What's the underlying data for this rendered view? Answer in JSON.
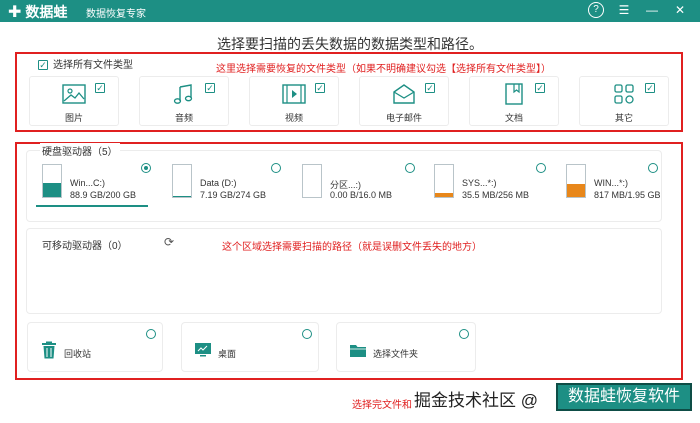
{
  "titlebar": {
    "logo_glyph": "✚",
    "app_name": "数据蛙",
    "subtitle": "数据恢复专家",
    "help_glyph": "?",
    "menu_glyph": "☰",
    "minimize_glyph": "—",
    "close_glyph": "✕",
    "color": "#1d8f84"
  },
  "heading": "选择要扫描的丢失数据的数据类型和路径。",
  "types": {
    "select_all_label": "选择所有文件类型",
    "check_glyph": "✓",
    "annotation": "这里选择需要恢复的文件类型（如果不明确建议勾选【选择所有文件类型】）",
    "items": [
      {
        "label": "图片",
        "icon": "image-icon"
      },
      {
        "label": "音频",
        "icon": "music-icon"
      },
      {
        "label": "视频",
        "icon": "video-icon"
      },
      {
        "label": "电子邮件",
        "icon": "email-icon"
      },
      {
        "label": "文档",
        "icon": "document-icon"
      },
      {
        "label": "其它",
        "icon": "other-icon"
      }
    ]
  },
  "drives": {
    "title": "硬盘驱动器（5）",
    "items": [
      {
        "name": "Win...C:)",
        "size": "88.9 GB/200 GB",
        "selected": true,
        "usage": 0.44,
        "fill": "#1d8f84"
      },
      {
        "name": "Data (D:)",
        "size": "7.19 GB/274 GB",
        "selected": false,
        "usage": 0.03,
        "fill": "#1d8f84"
      },
      {
        "name": "分区...:)",
        "size": "0.00  B/16.0 MB",
        "selected": false,
        "usage": 0.0,
        "fill": "#e8871a"
      },
      {
        "name": "SYS...*:)",
        "size": "35.5 MB/256 MB",
        "selected": false,
        "usage": 0.14,
        "fill": "#e8871a"
      },
      {
        "name": "WIN...*:)",
        "size": "817 MB/1.95 GB",
        "selected": false,
        "usage": 0.42,
        "fill": "#e8871a"
      }
    ]
  },
  "removable": {
    "title": "可移动驱动器（0）",
    "refresh_glyph": "⟳",
    "annotation": "这个区域选择需要扫描的路径（就是误删文件丢失的地方）"
  },
  "locations": [
    {
      "label": "回收站",
      "icon": "recycle-bin-icon"
    },
    {
      "label": "桌面",
      "icon": "desktop-icon"
    },
    {
      "label": "选择文件夹",
      "icon": "folder-icon"
    }
  ],
  "bottom_note": "选择完文件和",
  "watermark": "掘金技术社区 @",
  "banner": "数据蛙恢复软件"
}
